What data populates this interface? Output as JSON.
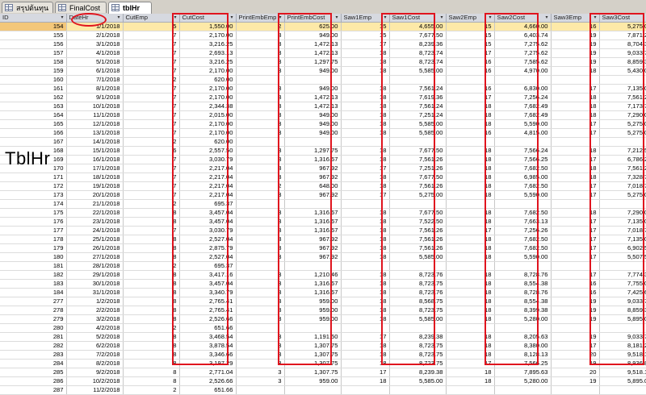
{
  "tabs": [
    {
      "label": "สรุปต้นทุน",
      "active": false
    },
    {
      "label": "FinalCost",
      "active": false
    },
    {
      "label": "tblHr",
      "active": true
    }
  ],
  "overlay_label": "TblHr",
  "columns": [
    "ID",
    "DateHr",
    "CutEmp",
    "CutCost",
    "PrintEmbEmp",
    "PrintEmbCost",
    "Saw1Emp",
    "Saw1Cost",
    "Saw2Emp",
    "Saw2Cost",
    "Saw3Emp",
    "Saw3Cost"
  ],
  "rows": [
    [
      "154",
      "1/1/2018",
      "5",
      "1,550.00",
      "2",
      "625.00",
      "15",
      "4,655.00",
      "15",
      "4,660.00",
      "16",
      "5,275.00"
    ],
    [
      "155",
      "2/1/2018",
      "7",
      "2,170.00",
      "3",
      "949.00",
      "15",
      "7,677.50",
      "15",
      "6,403.74",
      "19",
      "7,871.25"
    ],
    [
      "156",
      "3/1/2018",
      "7",
      "3,216.25",
      "3",
      "1,472.13",
      "17",
      "8,239.36",
      "15",
      "7,275.62",
      "19",
      "8,704.38"
    ],
    [
      "157",
      "4/1/2018",
      "7",
      "2,693.13",
      "3",
      "1,472.13",
      "18",
      "8,723.74",
      "17",
      "7,275.62",
      "19",
      "9,033.75"
    ],
    [
      "158",
      "5/1/2018",
      "7",
      "3,216.25",
      "3",
      "1,297.75",
      "18",
      "8,723.74",
      "16",
      "7,585.62",
      "19",
      "8,859.38"
    ],
    [
      "159",
      "6/1/2018",
      "7",
      "2,170.00",
      "3",
      "949.00",
      "18",
      "5,585.00",
      "16",
      "4,970.00",
      "18",
      "5,430.00"
    ],
    [
      "160",
      "7/1/2018",
      "2",
      "620.00",
      "",
      "",
      "",
      "",
      "",
      "",
      "",
      ""
    ],
    [
      "161",
      "8/1/2018",
      "7",
      "2,170.00",
      "3",
      "949.00",
      "18",
      "7,561.24",
      "16",
      "6,830.00",
      "17",
      "7,135.00"
    ],
    [
      "162",
      "9/1/2018",
      "7",
      "2,170.00",
      "3",
      "1,472.13",
      "18",
      "7,619.36",
      "17",
      "7,256.24",
      "18",
      "7,561.24"
    ],
    [
      "163",
      "10/1/2018",
      "7",
      "2,344.38",
      "3",
      "1,472.13",
      "18",
      "7,561.24",
      "18",
      "7,682.49",
      "18",
      "7,173.74"
    ],
    [
      "164",
      "11/1/2018",
      "7",
      "2,015.00",
      "3",
      "949.00",
      "18",
      "7,251.24",
      "18",
      "7,682.49",
      "18",
      "7,290.00"
    ],
    [
      "165",
      "12/1/2018",
      "7",
      "2,170.00",
      "3",
      "949.00",
      "18",
      "5,585.00",
      "18",
      "5,590.00",
      "17",
      "5,275.00"
    ],
    [
      "166",
      "13/1/2018",
      "7",
      "2,170.00",
      "3",
      "949.00",
      "18",
      "5,585.00",
      "16",
      "4,815.00",
      "17",
      "5,275.00"
    ],
    [
      "167",
      "14/1/2018",
      "2",
      "620.00",
      "",
      "",
      "",
      "",
      "",
      "",
      "",
      ""
    ],
    [
      "168",
      "15/1/2018",
      "6",
      "2,557.50",
      "3",
      "1,297.75",
      "18",
      "7,677.50",
      "18",
      "7,566.24",
      "18",
      "7,212.50"
    ],
    [
      "169",
      "16/1/2018",
      "7",
      "3,030.79",
      "3",
      "1,316.67",
      "18",
      "7,561.26",
      "18",
      "7,566.25",
      "17",
      "6,786.25"
    ],
    [
      "170",
      "17/1/2018",
      "7",
      "2,217.04",
      "3",
      "967.92",
      "17",
      "7,251.26",
      "18",
      "7,682.50",
      "18",
      "7,561.25"
    ],
    [
      "171",
      "18/1/2018",
      "7",
      "2,217.04",
      "3",
      "967.92",
      "18",
      "7,677.50",
      "18",
      "6,985.00",
      "18",
      "7,328.75"
    ],
    [
      "172",
      "19/1/2018",
      "7",
      "2,217.04",
      "2",
      "648.00",
      "18",
      "7,561.26",
      "18",
      "7,682.50",
      "17",
      "7,018.75"
    ],
    [
      "173",
      "20/1/2018",
      "7",
      "2,217.04",
      "3",
      "967.92",
      "17",
      "5,275.00",
      "18",
      "5,590.00",
      "17",
      "5,275.00"
    ],
    [
      "174",
      "21/1/2018",
      "2",
      "695.37",
      "",
      "",
      "",
      "",
      "",
      "",
      "",
      ""
    ],
    [
      "175",
      "22/1/2018",
      "8",
      "3,457.04",
      "3",
      "1,316.67",
      "18",
      "7,677.50",
      "18",
      "7,682.50",
      "18",
      "7,290.00"
    ],
    [
      "176",
      "23/1/2018",
      "8",
      "3,457.04",
      "3",
      "1,316.67",
      "18",
      "7,522.50",
      "18",
      "7,663.13",
      "17",
      "7,135.00"
    ],
    [
      "177",
      "24/1/2018",
      "7",
      "3,030.79",
      "3",
      "1,316.67",
      "18",
      "7,561.26",
      "17",
      "7,256.26",
      "17",
      "7,018.75"
    ],
    [
      "178",
      "25/1/2018",
      "8",
      "2,527.04",
      "3",
      "967.92",
      "18",
      "7,561.26",
      "18",
      "7,682.50",
      "17",
      "7,135.00"
    ],
    [
      "179",
      "26/1/2018",
      "8",
      "2,875.79",
      "3",
      "967.92",
      "18",
      "7,561.26",
      "18",
      "7,682.50",
      "17",
      "6,902.50"
    ],
    [
      "180",
      "27/1/2018",
      "8",
      "2,527.04",
      "3",
      "967.92",
      "18",
      "5,585.00",
      "18",
      "5,590.00",
      "17",
      "5,507.50"
    ],
    [
      "181",
      "28/1/2018",
      "2",
      "695.37",
      "",
      "",
      "",
      "",
      "",
      "",
      "",
      ""
    ],
    [
      "182",
      "29/1/2018",
      "8",
      "3,417.16",
      "3",
      "1,210.46",
      "18",
      "8,723.76",
      "18",
      "8,728.76",
      "17",
      "7,774.38"
    ],
    [
      "183",
      "30/1/2018",
      "8",
      "3,457.04",
      "3",
      "1,316.67",
      "18",
      "8,723.75",
      "18",
      "8,554.38",
      "16",
      "7,755.00"
    ],
    [
      "184",
      "31/1/2018",
      "8",
      "3,340.79",
      "3",
      "1,316.67",
      "18",
      "8,723.76",
      "18",
      "8,728.76",
      "16",
      "7,425.63"
    ],
    [
      "277",
      "1/2/2018",
      "8",
      "2,765.41",
      "3",
      "959.00",
      "18",
      "8,568.75",
      "18",
      "8,554.38",
      "19",
      "9,033.75"
    ],
    [
      "278",
      "2/2/2018",
      "8",
      "2,765.41",
      "3",
      "959.00",
      "18",
      "8,723.75",
      "18",
      "8,399.38",
      "19",
      "8,859.38"
    ],
    [
      "279",
      "3/2/2018",
      "8",
      "2,526.66",
      "3",
      "959.00",
      "18",
      "5,585.00",
      "18",
      "5,280.00",
      "19",
      "5,895.00"
    ],
    [
      "280",
      "4/2/2018",
      "2",
      "651.66",
      "",
      "",
      "",
      "",
      "",
      "",
      "",
      ""
    ],
    [
      "281",
      "5/2/2018",
      "8",
      "3,468.54",
      "3",
      "1,191.50",
      "17",
      "8,239.38",
      "18",
      "8,205.63",
      "19",
      "9,033.75"
    ],
    [
      "282",
      "6/2/2018",
      "8",
      "3,878.54",
      "3",
      "1,307.75",
      "18",
      "8,723.75",
      "18",
      "8,380.00",
      "17",
      "8,181.25"
    ],
    [
      "283",
      "7/2/2018",
      "8",
      "3,346.66",
      "3",
      "1,307.75",
      "18",
      "8,723.75",
      "18",
      "8,128.13",
      "20",
      "9,518.13"
    ],
    [
      "284",
      "8/2/2018",
      "8",
      "3,197.29",
      "3",
      "1,307.75",
      "18",
      "8,723.75",
      "17",
      "7,566.25",
      "19",
      "8,936.88"
    ],
    [
      "285",
      "9/2/2018",
      "8",
      "2,771.04",
      "3",
      "1,307.75",
      "17",
      "8,239.38",
      "18",
      "7,895.63",
      "20",
      "9,518.13"
    ],
    [
      "286",
      "10/2/2018",
      "8",
      "2,526.66",
      "3",
      "959.00",
      "18",
      "5,585.00",
      "18",
      "5,280.00",
      "19",
      "5,895.00"
    ],
    [
      "287",
      "11/2/2018",
      "2",
      "651.66",
      "",
      "",
      "",
      "",
      "",
      "",
      "",
      ""
    ]
  ],
  "annotation_color": "#e0141e",
  "selected_row_index": 0,
  "header_dropdown_glyph": "▾",
  "close_glyph": "×"
}
